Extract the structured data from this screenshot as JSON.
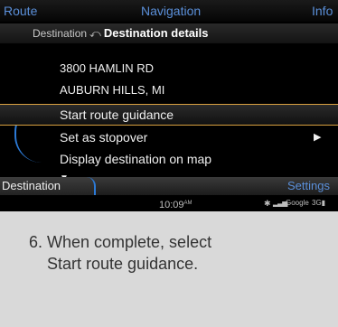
{
  "top_bar": {
    "left": "Route",
    "center": "Navigation",
    "right": "Info"
  },
  "breadcrumb": {
    "parent": "Destination",
    "current": "Destination details"
  },
  "address": {
    "line1": "3800 HAMLIN RD",
    "line2": "AUBURN HILLS, MI"
  },
  "menu": {
    "items": [
      {
        "label": "Start route guidance"
      },
      {
        "label": "Set as stopover"
      },
      {
        "label": "Display destination on map"
      }
    ]
  },
  "bottom_bar": {
    "left_tab": "Destination",
    "right": "Settings"
  },
  "status": {
    "time": "10:09",
    "ampm": "AM",
    "google": "Google",
    "network": "3G"
  },
  "caption": {
    "number": "6.",
    "line1": "When complete, select",
    "line2": "Start route guidance."
  },
  "colors": {
    "accent_blue": "#5a8fd9",
    "selection_gold": "#d8a040"
  }
}
